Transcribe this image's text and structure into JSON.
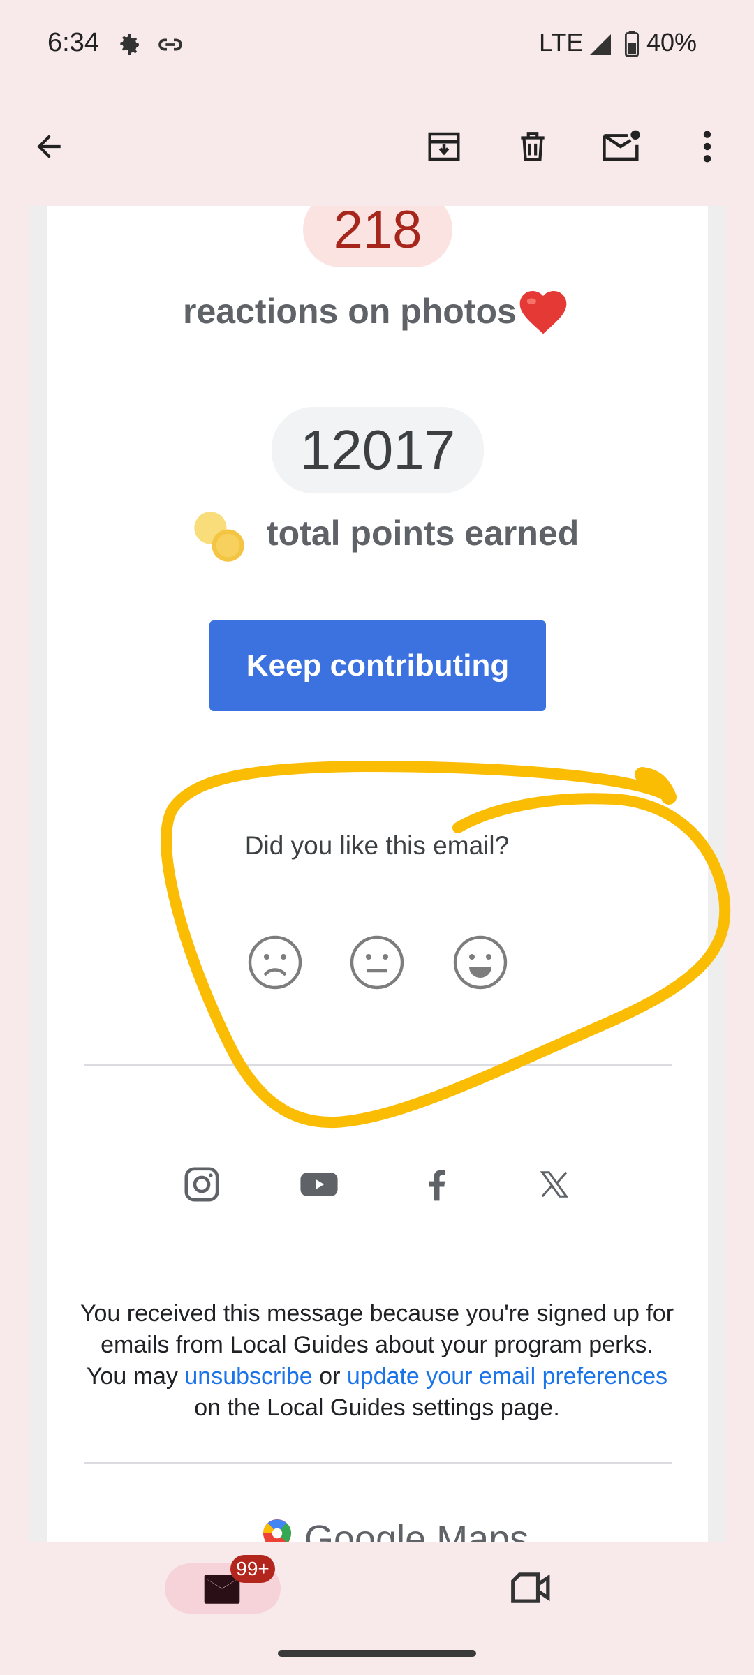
{
  "status_bar": {
    "time": "6:34",
    "network": "LTE",
    "battery": "40%",
    "icons": [
      "settings-gear-icon",
      "link-icon",
      "signal-icon",
      "battery-icon"
    ]
  },
  "toolbar": {
    "icons": [
      "back-arrow-icon",
      "archive-icon",
      "delete-icon",
      "mark-unread-icon",
      "more-vert-icon"
    ]
  },
  "email": {
    "stat1_value": "218",
    "stat1_label": "reactions on photos",
    "stat2_value": "12017",
    "stat2_label": "total points earned",
    "cta_label": "Keep contributing",
    "feedback_question": "Did you like this email?",
    "feedback_icons": [
      "sad-face-icon",
      "neutral-face-icon",
      "happy-face-icon"
    ],
    "social_icons": [
      "instagram-icon",
      "youtube-icon",
      "facebook-icon",
      "x-icon"
    ],
    "footer": {
      "line1": "You received this message because you're signed up for",
      "line2": "emails from Local Guides about your program perks.",
      "line3_pre": "You may ",
      "unsubscribe_link": "unsubscribe",
      "line3_mid": " or ",
      "preferences_link": "update your email preferences",
      "line4": "on the Local Guides settings page."
    },
    "brand_text": "Google Maps"
  },
  "bottom_nav": {
    "mail_badge": "99+",
    "icons": [
      "mail-icon",
      "meet-video-icon"
    ]
  },
  "colors": {
    "accent_button": "#3b72e0",
    "highlight_stroke": "#fbbc04",
    "badge": "#b3261e"
  }
}
